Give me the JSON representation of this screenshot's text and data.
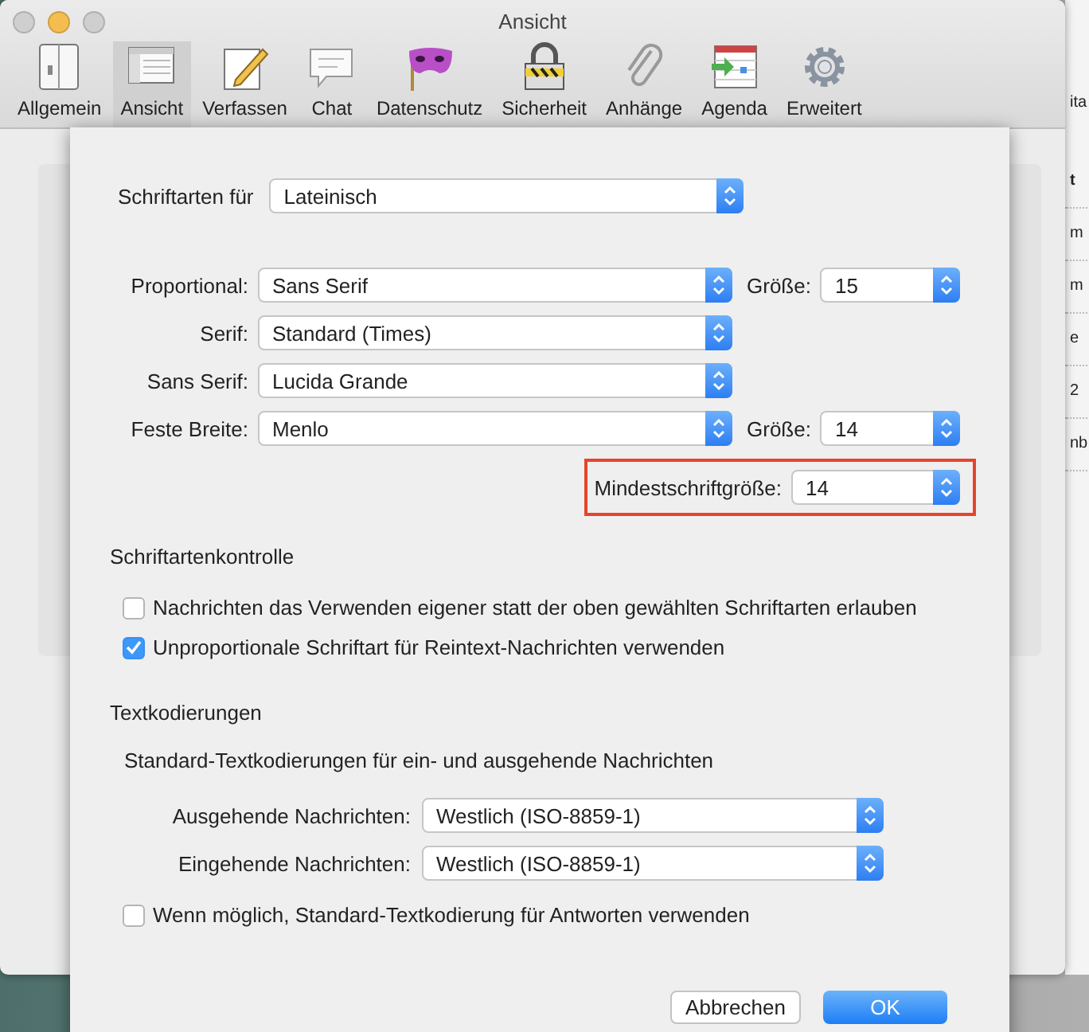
{
  "window": {
    "title": "Ansicht"
  },
  "toolbar": [
    {
      "label": "Allgemein",
      "kind": "general",
      "selected": false
    },
    {
      "label": "Ansicht",
      "kind": "view",
      "selected": true
    },
    {
      "label": "Verfassen",
      "kind": "compose",
      "selected": false
    },
    {
      "label": "Chat",
      "kind": "chat",
      "selected": false
    },
    {
      "label": "Datenschutz",
      "kind": "privacy",
      "selected": false
    },
    {
      "label": "Sicherheit",
      "kind": "security",
      "selected": false
    },
    {
      "label": "Anhänge",
      "kind": "attachments",
      "selected": false
    },
    {
      "label": "Agenda",
      "kind": "calendar",
      "selected": false
    },
    {
      "label": "Erweitert",
      "kind": "advanced",
      "selected": false
    }
  ],
  "background": {
    "right_fragments": [
      "ita",
      "t",
      "m",
      "m",
      "e",
      "2",
      "nb"
    ]
  },
  "sheet": {
    "script_row": {
      "label": "Schriftarten für",
      "value": "Lateinisch"
    },
    "font_rows": [
      {
        "label": "Proportional:",
        "value": "Sans Serif",
        "size_label": "Größe:",
        "size": "15"
      },
      {
        "label": "Serif:",
        "value": "Standard (Times)"
      },
      {
        "label": "Sans Serif:",
        "value": "Lucida Grande"
      },
      {
        "label": "Feste Breite:",
        "value": "Menlo",
        "size_label": "Größe:",
        "size": "14"
      }
    ],
    "minimum_size": {
      "label": "Mindestschriftgröße:",
      "value": "14",
      "highlighted": true
    },
    "font_control": {
      "heading": "Schriftartenkontrolle",
      "options": [
        {
          "label": "Nachrichten das Verwenden eigener statt der oben gewählten Schriftarten erlauben",
          "checked": false
        },
        {
          "label": "Unproportionale Schriftart für Reintext-Nachrichten verwenden",
          "checked": true
        }
      ]
    },
    "encodings": {
      "heading": "Textkodierungen",
      "subheading": "Standard-Textkodierungen für ein- und ausgehende Nachrichten",
      "rows": [
        {
          "label": "Ausgehende Nachrichten:",
          "value": "Westlich (ISO-8859-1)"
        },
        {
          "label": "Eingehende Nachrichten:",
          "value": "Westlich (ISO-8859-1)"
        }
      ],
      "option": {
        "label": "Wenn möglich, Standard-Textkodierung für Antworten verwenden",
        "checked": false
      }
    },
    "buttons": [
      {
        "label": "Abbrechen",
        "kind": "cancel"
      },
      {
        "label": "OK",
        "kind": "default"
      }
    ]
  }
}
